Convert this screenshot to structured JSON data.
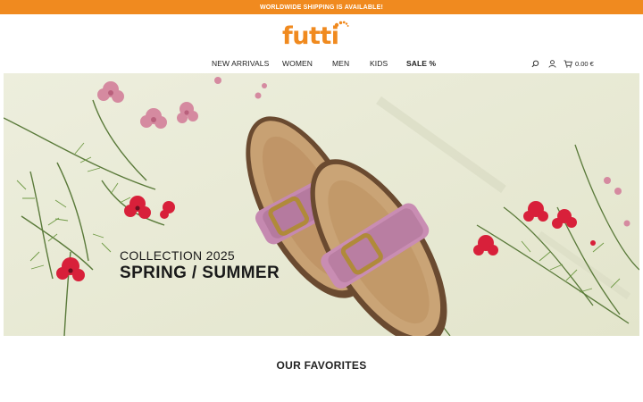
{
  "promo": {
    "text": "WORLDWIDE SHIPPING IS AVAILABLE!"
  },
  "brand": {
    "logo_text": "futti",
    "accent": "#f08a1f"
  },
  "nav": {
    "items": [
      {
        "label": "NEW ARRIVALS"
      },
      {
        "label": "WOMEN"
      },
      {
        "label": "MEN"
      },
      {
        "label": "KIDS"
      },
      {
        "label": "SALE %"
      }
    ]
  },
  "header": {
    "icons": [
      "search-icon",
      "user-icon",
      "cart-icon"
    ],
    "cart_total": "0.00 €"
  },
  "hero": {
    "subtitle": "COLLECTION 2025",
    "title": "SPRING / SUMMER"
  },
  "favorites": {
    "title": "OUR FAVORITES"
  }
}
